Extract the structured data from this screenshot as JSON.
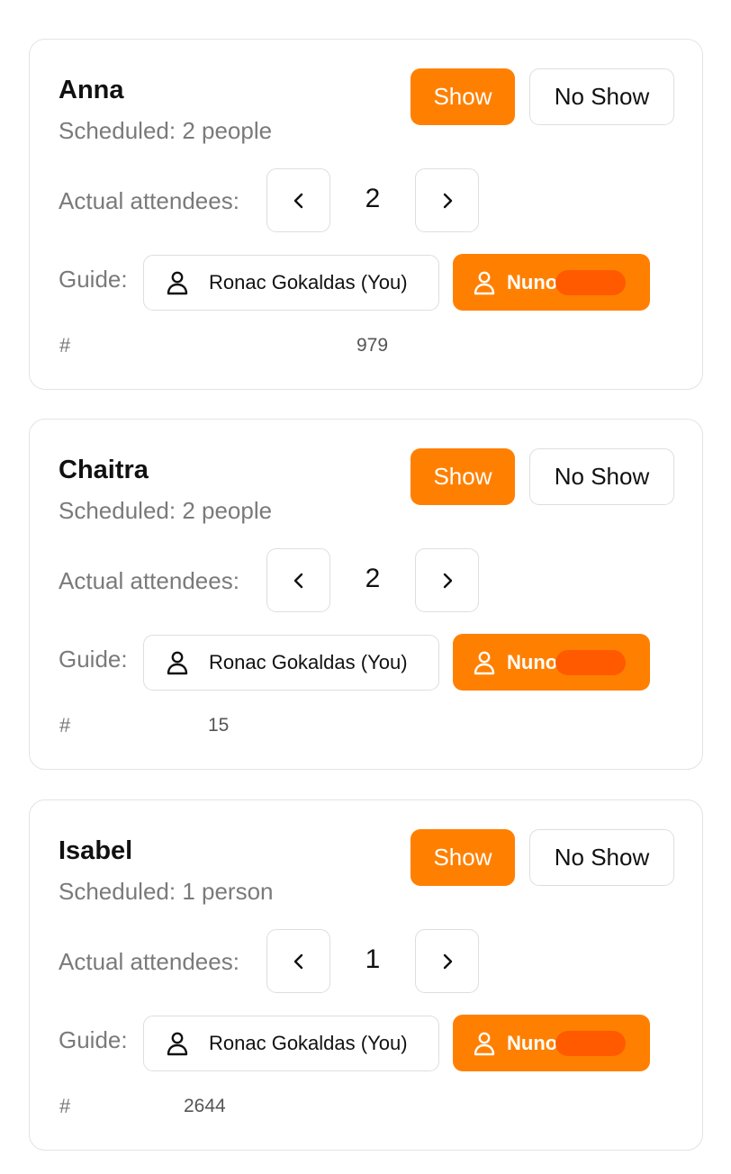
{
  "bookings": [
    {
      "name": "Anna",
      "scheduled": "Scheduled: 2 people",
      "show_label": "Show",
      "no_show_label": "No Show",
      "attendees_label": "Actual attendees:",
      "attendees_count": "2",
      "guide_label": "Guide:",
      "guide_self": "Ronac Gokaldas (You)",
      "guide_other": "Nuno",
      "hash_symbol": "#",
      "booking_code": "979"
    },
    {
      "name": "Chaitra",
      "scheduled": "Scheduled: 2 people",
      "show_label": "Show",
      "no_show_label": "No Show",
      "attendees_label": "Actual attendees:",
      "attendees_count": "2",
      "guide_label": "Guide:",
      "guide_self": "Ronac Gokaldas (You)",
      "guide_other": "Nuno",
      "hash_symbol": "#",
      "booking_code": "15"
    },
    {
      "name": "Isabel",
      "scheduled": "Scheduled: 1 person",
      "show_label": "Show",
      "no_show_label": "No Show",
      "attendees_label": "Actual attendees:",
      "attendees_count": "1",
      "guide_label": "Guide:",
      "guide_self": "Ronac Gokaldas (You)",
      "guide_other": "Nuno",
      "hash_symbol": "#",
      "booking_code": "2644"
    }
  ],
  "colors": {
    "accent": "#ff8000",
    "redaction": "#ff5a00",
    "muted_text": "#7a7a7a",
    "border": "#e3e3e3"
  },
  "icons": {
    "decrement": "chevron-left-icon",
    "increment": "chevron-right-icon",
    "guide": "person-icon"
  }
}
